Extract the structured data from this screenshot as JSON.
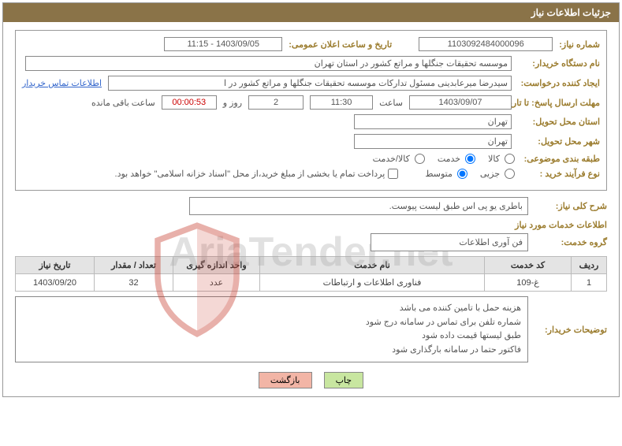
{
  "header": {
    "title": "جزئیات اطلاعات نیاز"
  },
  "fields": {
    "need_no_label": "شماره نیاز:",
    "need_no": "1103092484000096",
    "announce_label": "تاریخ و ساعت اعلان عمومی:",
    "announce_val": "1403/09/05 - 11:15",
    "buyer_org_label": "نام دستگاه خریدار:",
    "buyer_org_val": "موسسه تحقیقات جنگلها و مراتع کشور در استان تهران",
    "requester_label": "ایجاد کننده درخواست:",
    "requester_val": "سیدرضا میرعابدینی مسئول تدارکات موسسه تحقیقات جنگلها و مراتع کشور در ا",
    "buyer_contact_link": "اطلاعات تماس خریدار",
    "deadline_label": "مهلت ارسال پاسخ: تا تاریخ:",
    "deadline_date": "1403/09/07",
    "hour_word": "ساعت",
    "deadline_time": "11:30",
    "days_count": "2",
    "days_and_word": "روز و",
    "countdown": "00:00:53",
    "remaining_word": "ساعت باقی مانده",
    "province_label": "استان محل تحویل:",
    "province_val": "تهران",
    "city_label": "شهر محل تحویل:",
    "city_val": "تهران",
    "category_label": "طبقه بندی موضوعی:",
    "cat_opt1": "کالا",
    "cat_opt2": "خدمت",
    "cat_opt3": "کالا/خدمت",
    "process_label": "نوع فرآیند خرید :",
    "proc_opt1": "جزیی",
    "proc_opt2": "متوسط",
    "treasury_note": "پرداخت تمام یا بخشی از مبلغ خرید،از محل \"اسناد خزانه اسلامی\" خواهد بود."
  },
  "watermark": "AriaTender.net",
  "desc": {
    "label": "شرح کلی نیاز:",
    "value": "باطری یو پی اس طبق لیست پیوست."
  },
  "services_header": "اطلاعات خدمات مورد نیاز",
  "service_group": {
    "label": "گروه خدمت:",
    "value": "فن آوری اطلاعات"
  },
  "table": {
    "headers": [
      "ردیف",
      "کد خدمت",
      "نام خدمت",
      "واحد اندازه گیری",
      "تعداد / مقدار",
      "تاریخ نیاز"
    ],
    "row": [
      "1",
      "غ-109",
      "فناوری اطلاعات و ارتباطات",
      "عدد",
      "32",
      "1403/09/20"
    ]
  },
  "buyer_notes": {
    "label": "توضیحات خریدار:",
    "lines": [
      "هزینه حمل با تامین کننده می باشد",
      "شماره تلفن برای تماس در سامانه درج شود",
      "طبق لیستها قیمت داده شود",
      "فاکتور حتما در سامانه بارگذاری شود"
    ]
  },
  "buttons": {
    "print": "چاپ",
    "back": "بازگشت"
  }
}
